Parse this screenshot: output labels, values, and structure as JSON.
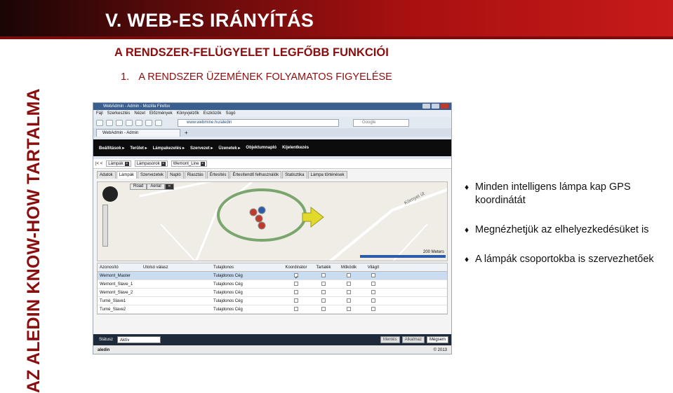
{
  "header": {
    "title": "V. WEB-ES IRÁNYÍTÁS"
  },
  "sidebar": {
    "vertical_title": "AZ ALEDIN KNOW-HOW TARTALMA"
  },
  "subtitle": "A RENDSZER-FELÜGYELET LEGFŐBB FUNKCIÓI",
  "section": {
    "number": "1.",
    "title": "A RENDSZER ÜZEMÉNEK FOLYAMATOS FIGYELÉSE"
  },
  "bullets": [
    "Minden  intelligens lámpa kap GPS koordinátát",
    "Megnézhetjük az elhelyezkedésüket is",
    "A lámpák csoportokba is szervezhetőek"
  ],
  "browser": {
    "window_title": "WebAdmin - Admin - Mozilla Firefox",
    "menu": [
      "Fájl",
      "Szerkesztés",
      "Nézet",
      "Előzmények",
      "Könyvjelzők",
      "Eszközök",
      "Súgó"
    ],
    "url": "www.webmine.hu/aledin",
    "search_placeholder": "Google",
    "tab_label": "WebAdmin - Admin",
    "app_nav": [
      "Beállítások ▸",
      "Terület ▸",
      "Lámpakezelés ▸",
      "Szervezet ▸",
      "Üzenetek ▸",
      "Objektumnapló",
      "Kijelentkezés"
    ],
    "crumbs": [
      "Lámpák",
      "Lámpasorok",
      "Wemont_Line"
    ],
    "subtabs": [
      "Adatok",
      "Lámpák",
      "Szervezetek",
      "Napló",
      "Riasztás",
      "Értesítés",
      "Értesítendő felhasználók",
      "Statisztika",
      "Lámpa történések"
    ],
    "map": {
      "road_label": "Road",
      "aerial_label": "Aerial",
      "street_label": "Környei út",
      "scale_label": "200 Meters"
    },
    "table": {
      "headers": [
        "Azonosító",
        "Utolsó válasz",
        "Tulajdonos",
        "Koordinátor",
        "Tartalék",
        "Működik",
        "Világít"
      ],
      "rows": [
        {
          "id": "Wemont_Master",
          "owner": "Tulajdonos Cég",
          "coord": true
        },
        {
          "id": "Wemont_Slave_1",
          "owner": "Tulajdonos Cég",
          "coord": false
        },
        {
          "id": "Wemont_Slave_2",
          "owner": "Tulajdonos Cég",
          "coord": false
        },
        {
          "id": "Turnė_Slave1",
          "owner": "Tulajdonos Cég",
          "coord": false
        },
        {
          "id": "Turnė_Slave2",
          "owner": "Tulajdonos Cég",
          "coord": false
        }
      ]
    },
    "status": {
      "label": "Státusz",
      "value": "Aktív",
      "buttons": [
        "Mentés",
        "Alkalmaz",
        "Mégsem"
      ]
    },
    "footer": {
      "brand": "aledin",
      "copyright": "© 2013"
    }
  },
  "colors": {
    "brand_red": "#8b0d0d",
    "highlight_green": "#7aa66e",
    "arrow_yellow": "#e3d92a"
  }
}
